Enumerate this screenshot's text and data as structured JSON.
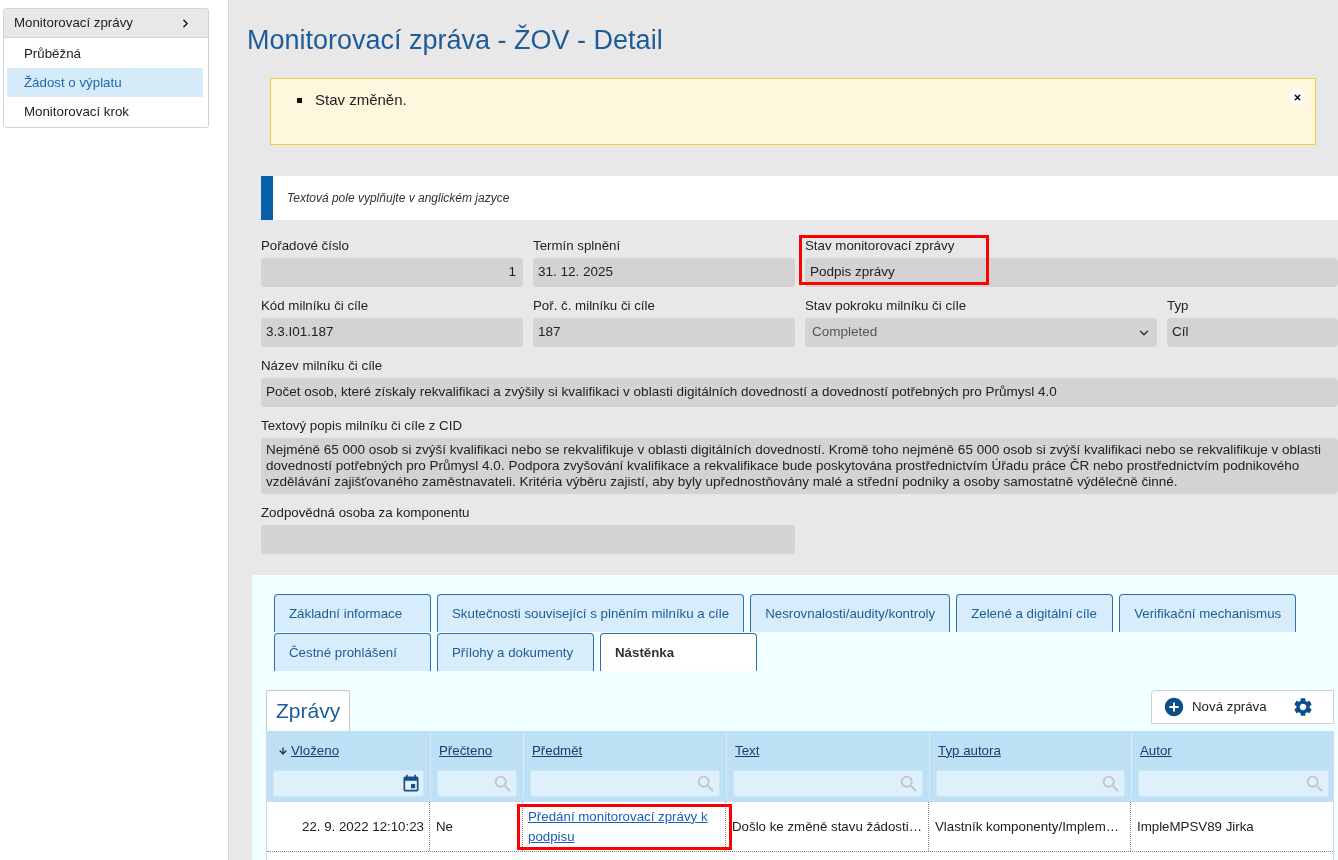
{
  "sidebar": {
    "menu": {
      "title": "Monitorovací zprávy",
      "items": [
        {
          "label": "Průběžná",
          "selected": false
        },
        {
          "label": "Žádost o výplatu",
          "selected": true
        },
        {
          "label": "Monitorovací krok",
          "selected": false
        }
      ]
    }
  },
  "page": {
    "title": "Monitorovací zpráva - ŽOV - Detail"
  },
  "alert": {
    "messages": [
      "Stav změněn."
    ]
  },
  "notice": {
    "text": "Textová pole vyplňujte v anglickém jazyce"
  },
  "form": {
    "rows": [
      {
        "fields": [
          {
            "label": "Pořadové číslo",
            "value": "1",
            "kind": "number",
            "highlighted": false
          },
          {
            "label": "Termín splnění",
            "value": "31. 12. 2025",
            "kind": "text",
            "highlighted": false
          },
          {
            "label": "Stav monitorovací zprávy",
            "value": "Podpis zprávy",
            "kind": "text",
            "highlighted": true
          }
        ]
      },
      {
        "fields": [
          {
            "label": "Kód milníku či cíle",
            "value": "3.3.I01.187",
            "kind": "text",
            "highlighted": false
          },
          {
            "label": "Poř. č. milníku či cíle",
            "value": "187",
            "kind": "text",
            "highlighted": false
          },
          {
            "label": "Stav pokroku milníku či cíle",
            "value": "Completed",
            "kind": "select",
            "highlighted": false
          },
          {
            "label": "Typ",
            "value": "Cíl",
            "kind": "text",
            "highlighted": false
          }
        ]
      },
      {
        "fields": [
          {
            "label": "Název milníku či cíle",
            "value": "Počet osob, které získaly rekvalifikaci a zvýšily si kvalifikaci v oblasti digitálních dovedností a dovedností potřebných pro Průmysl 4.0",
            "kind": "text",
            "highlighted": false
          }
        ]
      },
      {
        "fields": [
          {
            "label": "Textový popis milníku či cíle z CID",
            "value": "Nejméně 65 000 osob si zvýší kvalifikaci nebo se rekvalifikuje v oblasti digitálních dovedností. Kromě toho nejméně 65 000 osob si zvýší kvalifikaci nebo se rekvalifikuje v oblasti dovedností potřebných pro Průmysl 4.0. Podpora zvyšování kvalifikace a rekvalifikace bude poskytována prostřednictvím Úřadu práce ČR nebo prostřednictvím podnikového vzdělávání zajišťovaného zaměstnavateli. Kritéria výběru zajistí, aby byly upřednostňovány malé a střední podniky a osoby samostatně výdělečně činné.",
            "kind": "textarea",
            "highlighted": false
          }
        ]
      },
      {
        "fields": [
          {
            "label": "Zodpovědná osoba za komponentu",
            "kind": "text",
            "highlighted": false
          }
        ]
      }
    ]
  },
  "tabs": [
    {
      "label": "Základní informace",
      "selected": false
    },
    {
      "label": "Skutečnosti související s plněním milníku a cíle",
      "selected": false
    },
    {
      "label": "Nesrovnalosti/audity/kontroly",
      "selected": false
    },
    {
      "label": "Zelené a digitální cíle",
      "selected": false
    },
    {
      "label": "Verifikační mechanismus",
      "selected": false
    },
    {
      "label": "Čestné prohlášení",
      "selected": false
    },
    {
      "label": "Přílohy a dokumenty",
      "selected": false
    },
    {
      "label": "Nástěnka",
      "selected": true
    }
  ],
  "messages": {
    "tab": "Zprávy",
    "new_button": "Nová zpráva",
    "columns": [
      {
        "label": "Vloženo",
        "sorted": true,
        "kind": "date"
      },
      {
        "label": "Přečteno",
        "sorted": false,
        "kind": "text"
      },
      {
        "label": "Předmět",
        "sorted": false,
        "kind": "text"
      },
      {
        "label": "Text",
        "sorted": false,
        "kind": "text"
      },
      {
        "label": "Typ autora",
        "sorted": false,
        "kind": "text"
      },
      {
        "label": "Autor",
        "sorted": false,
        "kind": "text"
      }
    ],
    "rows": [
      {
        "cells": [
          {
            "text": "22. 9. 2022 12:10:23",
            "kind": "date",
            "highlighted": false
          },
          {
            "text": "Ne",
            "kind": "text",
            "highlighted": false
          },
          {
            "text": "Předání monitorovací zprávy k podpisu",
            "kind": "link",
            "highlighted": true
          },
          {
            "text": "Došlo ke změně stavu žádosti…",
            "kind": "text",
            "highlighted": false
          },
          {
            "text": "Vlastník komponenty/Implem…",
            "kind": "text",
            "highlighted": false
          },
          {
            "text": "ImpleMPSV89 Jirka",
            "kind": "text",
            "highlighted": false
          }
        ]
      }
    ]
  }
}
